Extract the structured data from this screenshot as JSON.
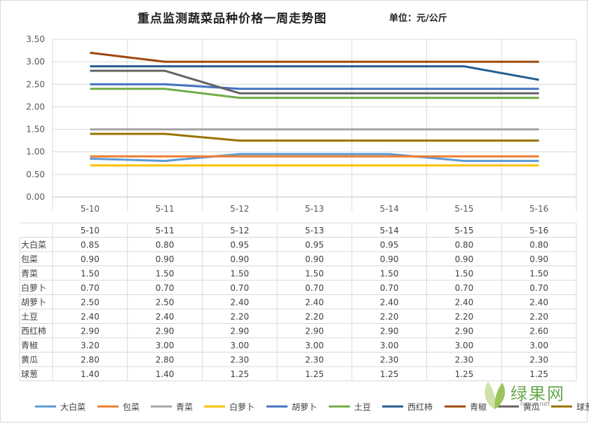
{
  "chart_data": {
    "type": "line",
    "title": "重点监测蔬菜品种价格一周走势图",
    "unit_label": "单位：元/公斤",
    "categories": [
      "5-10",
      "5-11",
      "5-12",
      "5-13",
      "5-14",
      "5-15",
      "5-16"
    ],
    "ylim": [
      0,
      3.5
    ],
    "yticks": [
      "0.00",
      "0.50",
      "1.00",
      "1.50",
      "2.00",
      "2.50",
      "3.00",
      "3.50"
    ],
    "grid": true,
    "legend_position": "bottom",
    "data_table": true,
    "series": [
      {
        "name": "大白菜",
        "color": "#5b9bd5",
        "values": [
          0.85,
          0.8,
          0.95,
          0.95,
          0.95,
          0.8,
          0.8
        ],
        "labels": [
          "0.85",
          "0.80",
          "0.95",
          "0.95",
          "0.95",
          "0.80",
          "0.80"
        ]
      },
      {
        "name": "包菜",
        "color": "#ed7d31",
        "values": [
          0.9,
          0.9,
          0.9,
          0.9,
          0.9,
          0.9,
          0.9
        ],
        "labels": [
          "0.90",
          "0.90",
          "0.90",
          "0.90",
          "0.90",
          "0.90",
          "0.90"
        ]
      },
      {
        "name": "青菜",
        "color": "#a5a5a5",
        "values": [
          1.5,
          1.5,
          1.5,
          1.5,
          1.5,
          1.5,
          1.5
        ],
        "labels": [
          "1.50",
          "1.50",
          "1.50",
          "1.50",
          "1.50",
          "1.50",
          "1.50"
        ]
      },
      {
        "name": "白萝卜",
        "color": "#ffc000",
        "values": [
          0.7,
          0.7,
          0.7,
          0.7,
          0.7,
          0.7,
          0.7
        ],
        "labels": [
          "0.70",
          "0.70",
          "0.70",
          "0.70",
          "0.70",
          "0.70",
          "0.70"
        ]
      },
      {
        "name": "胡萝卜",
        "color": "#4472c4",
        "values": [
          2.5,
          2.5,
          2.4,
          2.4,
          2.4,
          2.4,
          2.4
        ],
        "labels": [
          "2.50",
          "2.50",
          "2.40",
          "2.40",
          "2.40",
          "2.40",
          "2.40"
        ]
      },
      {
        "name": "土豆",
        "color": "#70ad47",
        "values": [
          2.4,
          2.4,
          2.2,
          2.2,
          2.2,
          2.2,
          2.2
        ],
        "labels": [
          "2.40",
          "2.40",
          "2.20",
          "2.20",
          "2.20",
          "2.20",
          "2.20"
        ]
      },
      {
        "name": "西红柿",
        "color": "#255e91",
        "values": [
          2.9,
          2.9,
          2.9,
          2.9,
          2.9,
          2.9,
          2.6
        ],
        "labels": [
          "2.90",
          "2.90",
          "2.90",
          "2.90",
          "2.90",
          "2.90",
          "2.60"
        ]
      },
      {
        "name": "青椒",
        "color": "#9e480e",
        "values": [
          3.2,
          3.0,
          3.0,
          3.0,
          3.0,
          3.0,
          3.0
        ],
        "labels": [
          "3.20",
          "3.00",
          "3.00",
          "3.00",
          "3.00",
          "3.00",
          "3.00"
        ]
      },
      {
        "name": "黄瓜",
        "color": "#636363",
        "values": [
          2.8,
          2.8,
          2.3,
          2.3,
          2.3,
          2.3,
          2.3
        ],
        "labels": [
          "2.80",
          "2.80",
          "2.30",
          "2.30",
          "2.30",
          "2.30",
          "2.30"
        ]
      },
      {
        "name": "球葱",
        "color": "#997300",
        "values": [
          1.4,
          1.4,
          1.25,
          1.25,
          1.25,
          1.25,
          1.25
        ],
        "labels": [
          "1.40",
          "1.40",
          "1.25",
          "1.25",
          "1.25",
          "1.25",
          "1.25"
        ]
      }
    ]
  },
  "watermark": {
    "brand": "绿果网",
    "url": "lvguo.net"
  }
}
